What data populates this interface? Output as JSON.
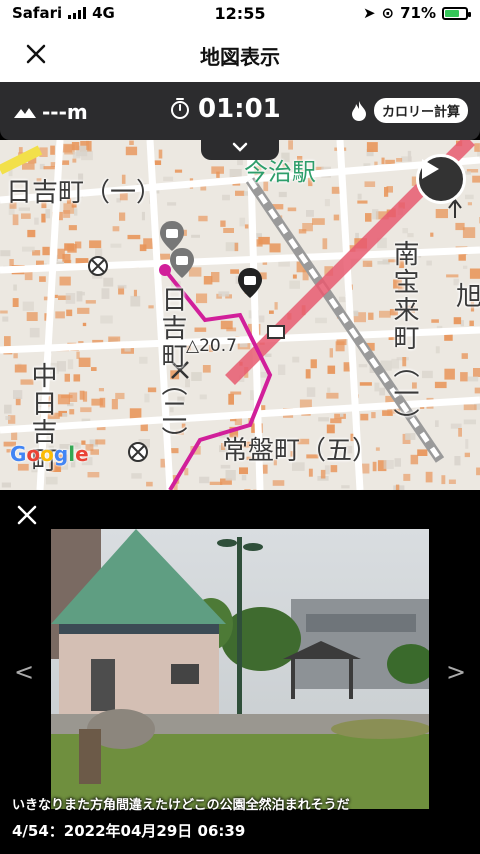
{
  "status": {
    "carrier": "Safari",
    "network": "4G",
    "time": "12:55",
    "battery": "71%",
    "battery_level": 0.71
  },
  "header": {
    "title": "地図表示"
  },
  "stats": {
    "altitude": "---m",
    "timer": "01:01",
    "calorie_button": "カロリー計算"
  },
  "map": {
    "labels": {
      "hiyoshi1": "日吉町（一）",
      "station": "今治駅",
      "minamihourai": "南宝来町（一）",
      "asahi": "旭",
      "hiyoshi2": "日吉町（二）",
      "elevation": "20.7",
      "nakahiyoshi": "中日吉町",
      "tokiwa": "常盤町（五）"
    },
    "attribution": "Google",
    "colors": {
      "route": "#d11f9a",
      "railway": "#e85a70",
      "building": "#e8955a"
    }
  },
  "viewer": {
    "caption": "いきなりまた方角間違えたけどこの公園全然泊まれそうだ",
    "meta": "4/54：2022年04月29日 06:39",
    "prev": "<",
    "next": ">"
  }
}
